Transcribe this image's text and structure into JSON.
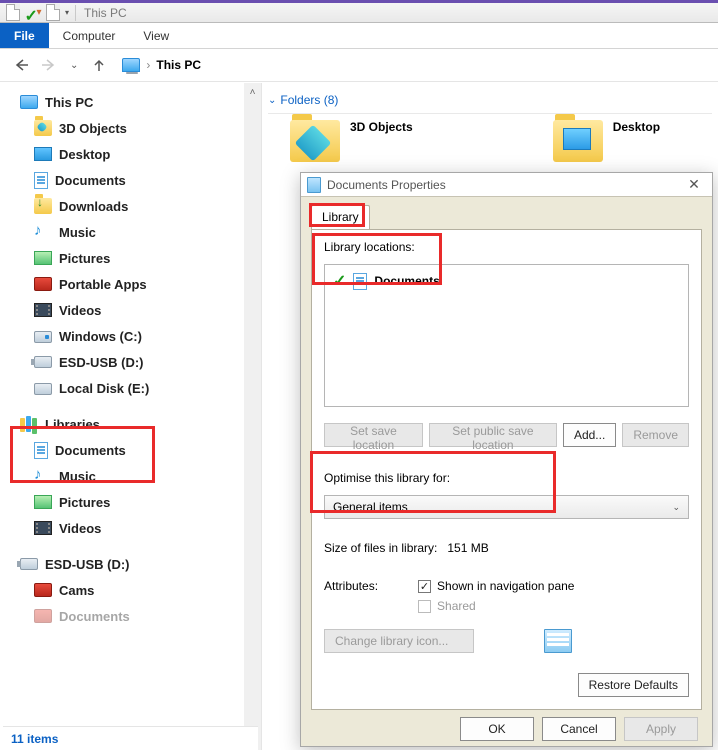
{
  "window": {
    "title": "This PC"
  },
  "ribbon": {
    "file": "File",
    "computer": "Computer",
    "view": "View"
  },
  "address": {
    "location": "This PC"
  },
  "sidebar": {
    "root": "This PC",
    "items": [
      {
        "label": "3D Objects"
      },
      {
        "label": "Desktop"
      },
      {
        "label": "Documents"
      },
      {
        "label": "Downloads"
      },
      {
        "label": "Music"
      },
      {
        "label": "Pictures"
      },
      {
        "label": "Portable Apps"
      },
      {
        "label": "Videos"
      },
      {
        "label": "Windows (C:)"
      },
      {
        "label": "ESD-USB (D:)"
      },
      {
        "label": "Local Disk (E:)"
      }
    ],
    "libraries": "Libraries",
    "lib_items": [
      {
        "label": "Documents"
      },
      {
        "label": "Music"
      },
      {
        "label": "Pictures"
      },
      {
        "label": "Videos"
      }
    ],
    "usb_root": "ESD-USB (D:)",
    "usb_items": [
      {
        "label": "Cams"
      },
      {
        "label": "Documents"
      }
    ]
  },
  "content": {
    "folders_header": "Folders (8)",
    "f3d": "3D Objects",
    "desktop": "Desktop"
  },
  "status": {
    "text": "11 items"
  },
  "dialog": {
    "title": "Documents Properties",
    "tab": "Library",
    "locations_label": "Library locations:",
    "location_name": "Documents",
    "btn_set": "Set save location",
    "btn_pub": "Set public save location",
    "btn_add": "Add...",
    "btn_rem": "Remove",
    "optimise_label": "Optimise this library for:",
    "optimise_value": "General items",
    "size_label": "Size of files in library:",
    "size_value": "151 MB",
    "attr_label": "Attributes:",
    "attr_nav": "Shown in navigation pane",
    "attr_shared": "Shared",
    "btn_change": "Change library icon...",
    "btn_restore": "Restore Defaults",
    "btn_ok": "OK",
    "btn_cancel": "Cancel",
    "btn_apply": "Apply"
  }
}
